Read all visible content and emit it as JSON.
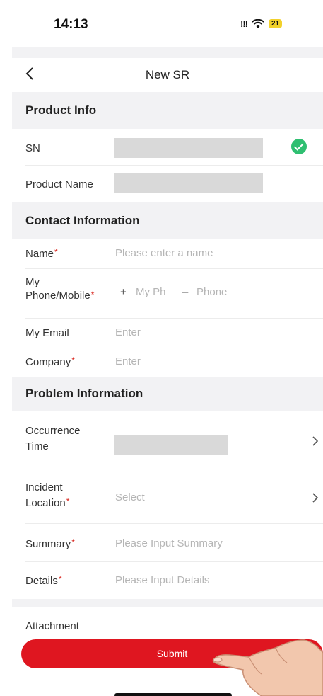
{
  "status_bar": {
    "time": "14:13",
    "signal": "!!!",
    "battery": "21"
  },
  "nav": {
    "title": "New SR"
  },
  "sections": {
    "product": "Product Info",
    "contact": "Contact Information",
    "problem": "Problem Information"
  },
  "product": {
    "sn_label": "SN",
    "name_label": "Product Name"
  },
  "contact": {
    "name_label": "Name",
    "name_placeholder": "Please enter a name",
    "phone_label_1": "My",
    "phone_label_2": "Phone/Mobile",
    "phone_country_prefix": "+",
    "phone_code_placeholder": "My Ph",
    "phone_separator": "–",
    "phone_number_placeholder": "Phone",
    "email_label": "My Email",
    "email_placeholder": "Enter",
    "company_label": "Company",
    "company_placeholder": "Enter"
  },
  "problem": {
    "occurrence_label_1": "Occurrence",
    "occurrence_label_2": "Time",
    "incident_label_1": "Incident",
    "incident_label_2": "Location",
    "incident_placeholder": "Select",
    "summary_label": "Summary",
    "summary_placeholder": "Please Input Summary",
    "details_label": "Details",
    "details_placeholder": "Please Input Details"
  },
  "attachment_label": "Attachment",
  "submit_label": "Submit",
  "required_mark": "*",
  "colors": {
    "accent": "#df1620",
    "success": "#2fbf71",
    "section_bg": "#f2f2f4"
  }
}
